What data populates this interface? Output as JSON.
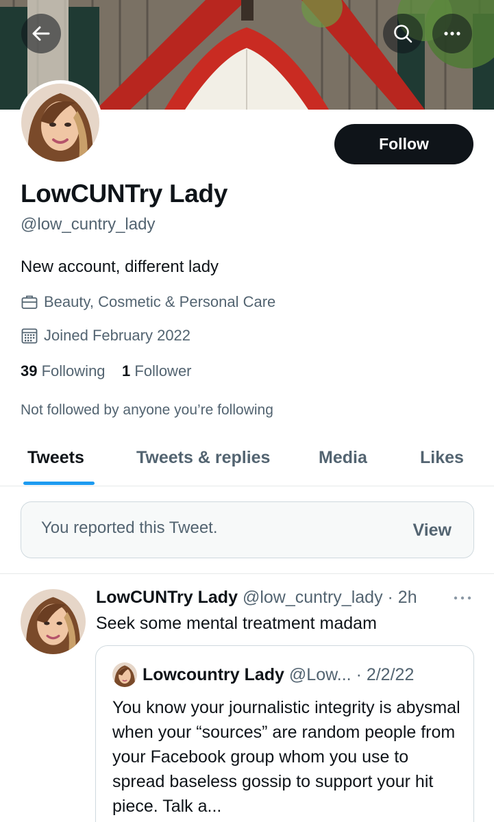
{
  "header": {
    "back_icon": "arrow-left-icon",
    "search_icon": "search-icon",
    "more_icon": "more-horizontal-icon"
  },
  "profile": {
    "display_name": "LowCUNTry Lady",
    "handle": "@low_cuntry_lady",
    "follow_label": "Follow",
    "bio": "New account, different lady",
    "category": "Beauty, Cosmetic & Personal Care",
    "joined": "Joined February 2022",
    "following_count": "39",
    "following_label": "Following",
    "followers_count": "1",
    "followers_label": "Follower",
    "not_followed_note": "Not followed by anyone you’re following"
  },
  "tabs": [
    {
      "label": "Tweets",
      "active": true
    },
    {
      "label": "Tweets & replies",
      "active": false
    },
    {
      "label": "Media",
      "active": false
    },
    {
      "label": "Likes",
      "active": false
    }
  ],
  "notice": {
    "text": "You reported this Tweet.",
    "action": "View"
  },
  "tweet": {
    "name": "LowCUNTry Lady",
    "handle_time": "@low_cuntry_lady · 2h",
    "text": "Seek some mental treatment madam",
    "quote": {
      "name": "Lowcountry Lady",
      "meta": "@Low... · 2/2/22",
      "text": "You know your journalistic integrity is abysmal when your “sources” are random people from your Facebook group whom you use to spread baseless gossip to support your hit piece. Talk a..."
    }
  },
  "colors": {
    "accent": "#1d9bf0",
    "text_primary": "#0f1419",
    "text_secondary": "#536471",
    "border": "#cfd9de"
  }
}
